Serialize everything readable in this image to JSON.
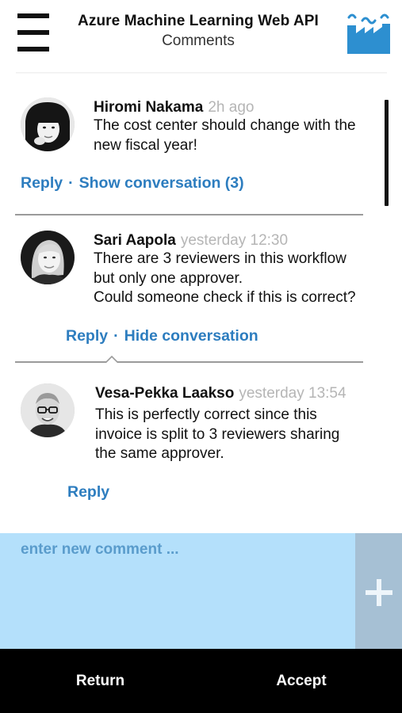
{
  "header": {
    "title": "Azure Machine Learning Web API",
    "subtitle": "Comments",
    "logo_icon": "factory-logo-icon",
    "accent": "#2d8fd0"
  },
  "comments": [
    {
      "author": "Hiromi Nakama",
      "time": "2h ago",
      "text": "The cost center should change with the\nnew fiscal year!",
      "reply_label": "Reply",
      "conversation_label": "Show conversation (3)"
    },
    {
      "author": "Sari Aapola",
      "time": "yesterday 12:30",
      "text": "There are 3 reviewers in this workflow\nbut only one approver.\nCould someone check if this is correct?",
      "reply_label": "Reply",
      "conversation_label": "Hide conversation"
    },
    {
      "author": "Vesa-Pekka Laakso",
      "time": "yesterday 13:54",
      "text": "This is perfectly correct since this\ninvoice is split to 3 reviewers sharing\nthe same approver.",
      "reply_label": "Reply"
    }
  ],
  "composer": {
    "placeholder": "enter new comment ...",
    "add_icon": "plus-icon"
  },
  "footer": {
    "return_label": "Return",
    "accept_label": "Accept"
  },
  "colors": {
    "link": "#2d7dbf",
    "composer_bg": "#b4e0fb",
    "add_bg": "#a6c0d4",
    "footer_bg": "#000000"
  },
  "separator": "·"
}
